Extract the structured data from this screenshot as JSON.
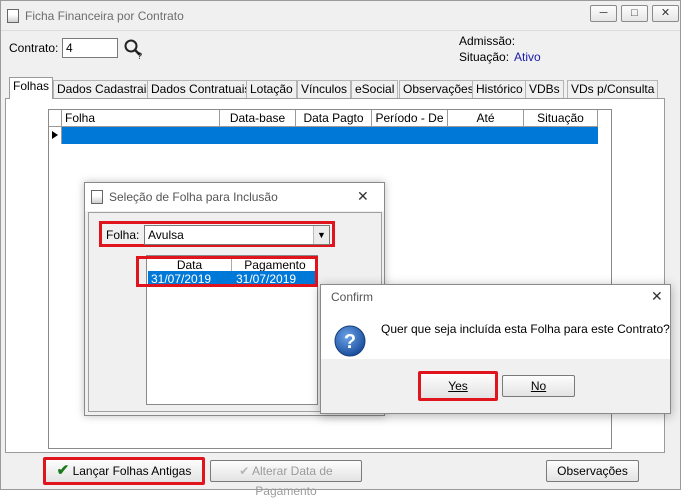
{
  "window": {
    "title": "Ficha Financeira por Contrato"
  },
  "header": {
    "contrato_label": "Contrato:",
    "contrato_value": "4",
    "admissao_label": "Admissão:",
    "admissao_value": "",
    "situacao_label": "Situação:",
    "situacao_value": "Ativo",
    "situacao_color": "#1a1aa8"
  },
  "tabs": [
    {
      "label": "Folhas"
    },
    {
      "label": "Dados Cadastrais"
    },
    {
      "label": "Dados Contratuais"
    },
    {
      "label": "Lotação"
    },
    {
      "label": "Vínculos"
    },
    {
      "label": "eSocial"
    },
    {
      "label": "Observações"
    },
    {
      "label": "Histórico"
    },
    {
      "label": "VDBs"
    },
    {
      "label": "VDs p/Consulta"
    }
  ],
  "grid": {
    "columns": [
      "Folha",
      "Data-base",
      "Data Pagto",
      "Período  - De",
      "Até",
      "Situação"
    ]
  },
  "footer": {
    "lancar_label": "Lançar Folhas Antigas",
    "alterar_label": "Alterar Data de Pagamento",
    "observacoes_label": "Observações"
  },
  "dialog_selecao": {
    "title": "Seleção de Folha para Inclusão",
    "folha_label": "Folha:",
    "folha_value": "Avulsa",
    "columns": [
      "Data",
      "Pagamento"
    ],
    "rows": [
      {
        "data": "31/07/2019",
        "pagamento": "31/07/2019"
      }
    ]
  },
  "confirm": {
    "title": "Confirm",
    "message": "Quer que seja incluída esta Folha para este Contrato?",
    "yes_label": "Yes",
    "no_label": "No"
  },
  "colors": {
    "highlight": "#0078d7",
    "callout": "#e0141d"
  }
}
